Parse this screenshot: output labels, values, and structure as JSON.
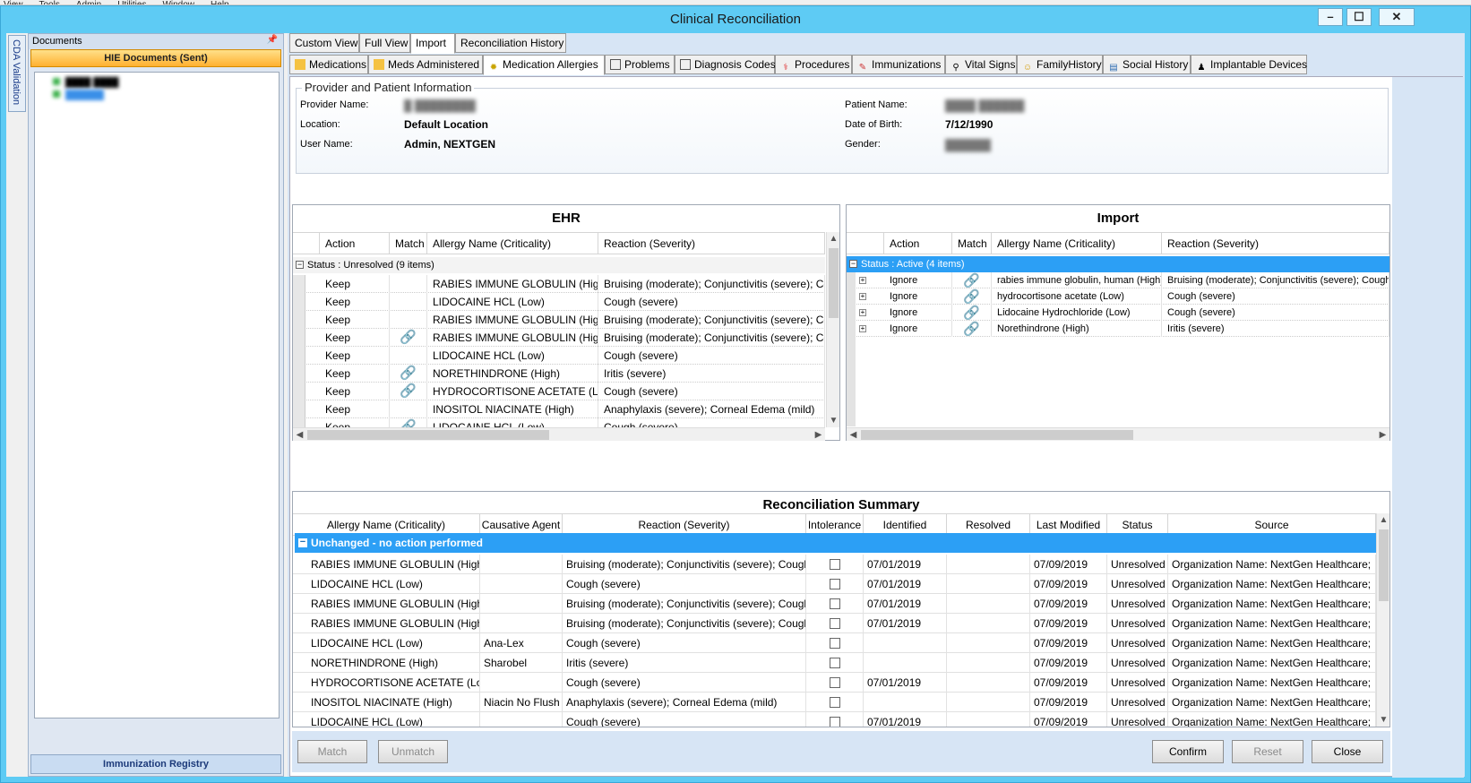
{
  "menu": [
    "View",
    "Tools",
    "Admin",
    "Utilities",
    "Window",
    "Help"
  ],
  "window": {
    "title": "Clinical Reconciliation",
    "min": "–",
    "max": "☐",
    "close": "✕"
  },
  "cda_tab": "CDA Validation",
  "documents": {
    "header": "Documents",
    "hie_label": "HIE Documents (Sent)",
    "tree": [
      "████ ████",
      "██████"
    ],
    "immunization_label": "Immunization Registry"
  },
  "tabs_top": [
    "Custom View",
    "Full View",
    "Import",
    "Reconciliation History"
  ],
  "tabs_second": [
    "Medications",
    "Meds Administered",
    "Medication Allergies",
    "Problems",
    "Diagnosis Codes",
    "Procedures",
    "Immunizations",
    "Vital Signs",
    "FamilyHistory",
    "Social History",
    "Implantable Devices"
  ],
  "provider_info": {
    "legend": "Provider and Patient Information",
    "provider_name_label": "Provider Name:",
    "provider_name": "█ ████████",
    "location_label": "Location:",
    "location": "Default Location",
    "user_name_label": "User Name:",
    "user_name": "Admin, NEXTGEN",
    "patient_name_label": "Patient Name:",
    "patient_name": "████ ██████",
    "dob_label": "Date of Birth:",
    "dob": "7/12/1990",
    "gender_label": "Gender:",
    "gender": "██████"
  },
  "ehr": {
    "title": "EHR",
    "columns": [
      "Action",
      "Match",
      "Allergy Name (Criticality)",
      "Reaction (Severity)"
    ],
    "group": "Status : Unresolved (9 items)",
    "rows": [
      {
        "action": "Keep",
        "match": "",
        "name": "RABIES IMMUNE GLOBULIN (High)",
        "reaction": "Bruising (moderate); Conjunctivitis (severe); Cough"
      },
      {
        "action": "Keep",
        "match": "",
        "name": "LIDOCAINE HCL (Low)",
        "reaction": "Cough (severe)"
      },
      {
        "action": "Keep",
        "match": "",
        "name": "RABIES IMMUNE GLOBULIN (High)",
        "reaction": "Bruising (moderate); Conjunctivitis (severe); Cough"
      },
      {
        "action": "Keep",
        "match": "link",
        "name": "RABIES IMMUNE GLOBULIN (High)",
        "reaction": "Bruising (moderate); Conjunctivitis (severe); Cough"
      },
      {
        "action": "Keep",
        "match": "",
        "name": "LIDOCAINE HCL (Low)",
        "reaction": "Cough (severe)"
      },
      {
        "action": "Keep",
        "match": "link",
        "name": "NORETHINDRONE (High)",
        "reaction": "Iritis (severe)"
      },
      {
        "action": "Keep",
        "match": "link",
        "name": "HYDROCORTISONE ACETATE (Low)",
        "reaction": "Cough (severe)"
      },
      {
        "action": "Keep",
        "match": "",
        "name": "INOSITOL NIACINATE (High)",
        "reaction": "Anaphylaxis (severe); Corneal Edema (mild)"
      },
      {
        "action": "Keep",
        "match": "link",
        "name": "LIDOCAINE HCL (Low)",
        "reaction": "Cough (severe)"
      }
    ]
  },
  "import": {
    "title": "Import",
    "columns": [
      "Action",
      "Match",
      "Allergy Name (Criticality)",
      "Reaction (Severity)"
    ],
    "group": "Status : Active (4 items)",
    "rows": [
      {
        "action": "Ignore",
        "match": "link",
        "name": "rabies immune globulin, human (High)",
        "reaction": "Bruising (moderate); Conjunctivitis (severe); Cough"
      },
      {
        "action": "Ignore",
        "match": "link",
        "name": "hydrocortisone acetate (Low)",
        "reaction": "Cough (severe)"
      },
      {
        "action": "Ignore",
        "match": "link",
        "name": "Lidocaine Hydrochloride (Low)",
        "reaction": "Cough (severe)"
      },
      {
        "action": "Ignore",
        "match": "link",
        "name": "Norethindrone (High)",
        "reaction": "Iritis (severe)"
      }
    ]
  },
  "summary": {
    "title": "Reconciliation Summary",
    "columns": [
      "Allergy Name (Criticality)",
      "Causative Agent",
      "Reaction (Severity)",
      "Intolerance",
      "Identified",
      "Resolved",
      "Last Modified",
      "Status",
      "Source"
    ],
    "group": "Unchanged - no action performed",
    "rows": [
      {
        "name": "RABIES IMMUNE GLOBULIN (High)",
        "agent": "",
        "reaction": "Bruising (moderate); Conjunctivitis (severe); Cough",
        "identified": "07/01/2019",
        "resolved": "",
        "modified": "07/09/2019",
        "status": "Unresolved",
        "source": "Organization Name: NextGen Healthcare;"
      },
      {
        "name": "LIDOCAINE HCL (Low)",
        "agent": "",
        "reaction": "Cough (severe)",
        "identified": "07/01/2019",
        "resolved": "",
        "modified": "07/09/2019",
        "status": "Unresolved",
        "source": "Organization Name: NextGen Healthcare;"
      },
      {
        "name": "RABIES IMMUNE GLOBULIN (High)",
        "agent": "",
        "reaction": "Bruising (moderate); Conjunctivitis (severe); Cough",
        "identified": "07/01/2019",
        "resolved": "",
        "modified": "07/09/2019",
        "status": "Unresolved",
        "source": "Organization Name: NextGen Healthcare;"
      },
      {
        "name": "RABIES IMMUNE GLOBULIN (High)",
        "agent": "",
        "reaction": "Bruising (moderate); Conjunctivitis (severe); Cough",
        "identified": "07/01/2019",
        "resolved": "",
        "modified": "07/09/2019",
        "status": "Unresolved",
        "source": "Organization Name: NextGen Healthcare;"
      },
      {
        "name": "LIDOCAINE HCL (Low)",
        "agent": "Ana-Lex",
        "reaction": "Cough (severe)",
        "identified": "",
        "resolved": "",
        "modified": "07/09/2019",
        "status": "Unresolved",
        "source": "Organization Name: NextGen Healthcare;"
      },
      {
        "name": "NORETHINDRONE (High)",
        "agent": "Sharobel",
        "reaction": "Iritis (severe)",
        "identified": "",
        "resolved": "",
        "modified": "07/09/2019",
        "status": "Unresolved",
        "source": "Organization Name: NextGen Healthcare;"
      },
      {
        "name": "HYDROCORTISONE ACETATE (Low)",
        "agent": "",
        "reaction": "Cough (severe)",
        "identified": "07/01/2019",
        "resolved": "",
        "modified": "07/09/2019",
        "status": "Unresolved",
        "source": "Organization Name: NextGen Healthcare;"
      },
      {
        "name": "INOSITOL NIACINATE (High)",
        "agent": "Niacin No Flush",
        "reaction": "Anaphylaxis (severe); Corneal Edema (mild)",
        "identified": "",
        "resolved": "",
        "modified": "07/09/2019",
        "status": "Unresolved",
        "source": "Organization Name: NextGen Healthcare;"
      },
      {
        "name": "LIDOCAINE HCL (Low)",
        "agent": "",
        "reaction": "Cough (severe)",
        "identified": "07/01/2019",
        "resolved": "",
        "modified": "07/09/2019",
        "status": "Unresolved",
        "source": "Organization Name: NextGen Healthcare;"
      }
    ]
  },
  "buttons": {
    "match": "Match",
    "unmatch": "Unmatch",
    "confirm": "Confirm",
    "reset": "Reset",
    "close": "Close"
  }
}
